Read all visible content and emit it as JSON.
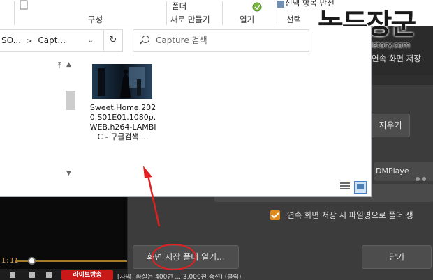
{
  "ribbon": {
    "group_organize": "구성",
    "new_folder_top": "폴더",
    "group_new": "새로 만들기",
    "group_open": "열기",
    "group_select": "선택",
    "select_top_partial": "선택 항목 반전"
  },
  "watermark": {
    "title": "녹두장군",
    "url": "http://mainia.tistory.com"
  },
  "explorer": {
    "path_segments": [
      "SO...",
      "Capt..."
    ],
    "refresh_symbol": "↻",
    "search_placeholder": "Capture 검색",
    "file": {
      "name": "Sweet.Home.2020.S01E01.1080p.WEB.h264-LAMBiC - 구글검색 ..."
    }
  },
  "player": {
    "time": "1:11",
    "live_badge": "라이브방송"
  },
  "dialog": {
    "title_right": "연속 화면 저장",
    "clear_button": "지우기",
    "player_combo": "DMPlaye",
    "field_hint": "",
    "checkbox_label": "연속 화면 저장 시 파일명으로 폴더 생",
    "open_folder_button": "화면 저장 폴더 열기...",
    "close_button": "닫기",
    "checkbox_checked": true
  },
  "subtitle_bar": "[자막] 화질은 400번 ... 3,000원 충전) (클릭)",
  "colors": {
    "accent_orange": "#e08a1e",
    "annotation_red": "#e02020",
    "dialog_bg": "#3c3c3c"
  }
}
